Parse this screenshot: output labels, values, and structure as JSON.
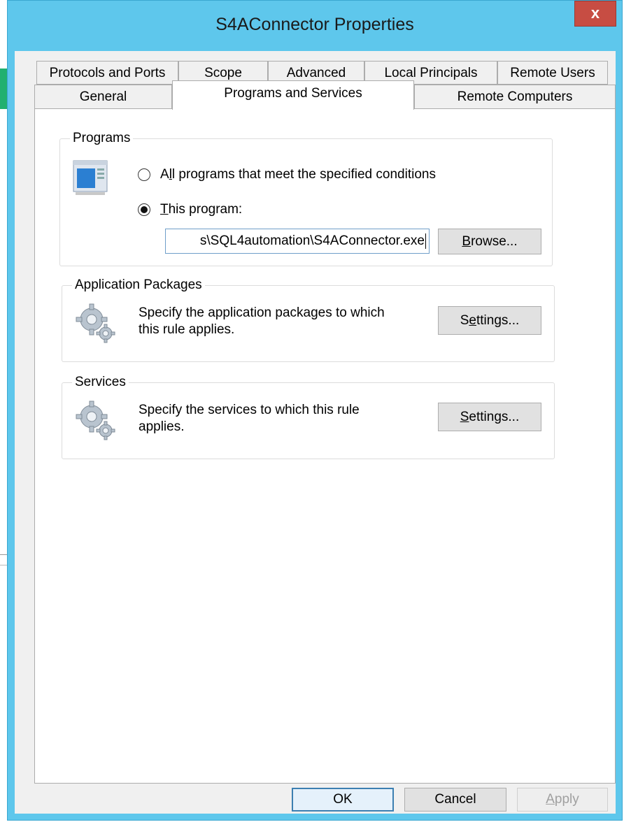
{
  "window": {
    "title": "S4AConnector Properties",
    "close_label": "x"
  },
  "tabs": {
    "row1": [
      "Protocols and Ports",
      "Scope",
      "Advanced",
      "Local Principals",
      "Remote Users"
    ],
    "row2": [
      "General",
      "Programs and Services",
      "Remote Computers"
    ],
    "active": "Programs and Services"
  },
  "programs": {
    "group_label": "Programs",
    "icon": "program-window-icon",
    "option_all": {
      "pre": "A",
      "mn": "l",
      "post": "l programs that meet the specified conditions",
      "checked": false
    },
    "option_this": {
      "pre": "",
      "mn": "T",
      "post": "his program:",
      "checked": true
    },
    "path_value": "s\\SQL4automation\\S4AConnector.exe",
    "browse_button": {
      "pre": "",
      "mn": "B",
      "post": "rowse..."
    }
  },
  "app_packages": {
    "group_label": "Application Packages",
    "icon": "gears-icon",
    "description_line1": "Specify the application packages to which",
    "description_line2": "this rule applies.",
    "settings_button": {
      "pre": "S",
      "mn": "e",
      "post": "ttings..."
    }
  },
  "services": {
    "group_label": "Services",
    "icon": "gears-icon",
    "description_line1": "Specify the services to which this rule",
    "description_line2": "applies.",
    "settings_button": {
      "pre": "",
      "mn": "S",
      "post": "ettings..."
    }
  },
  "footer": {
    "ok": "OK",
    "cancel": "Cancel",
    "apply": {
      "pre": "",
      "mn": "A",
      "post": "pply",
      "enabled": false
    }
  },
  "colors": {
    "titlebar": "#5ec7ec",
    "close": "#c74d43",
    "background_accent": "#21b06f"
  }
}
